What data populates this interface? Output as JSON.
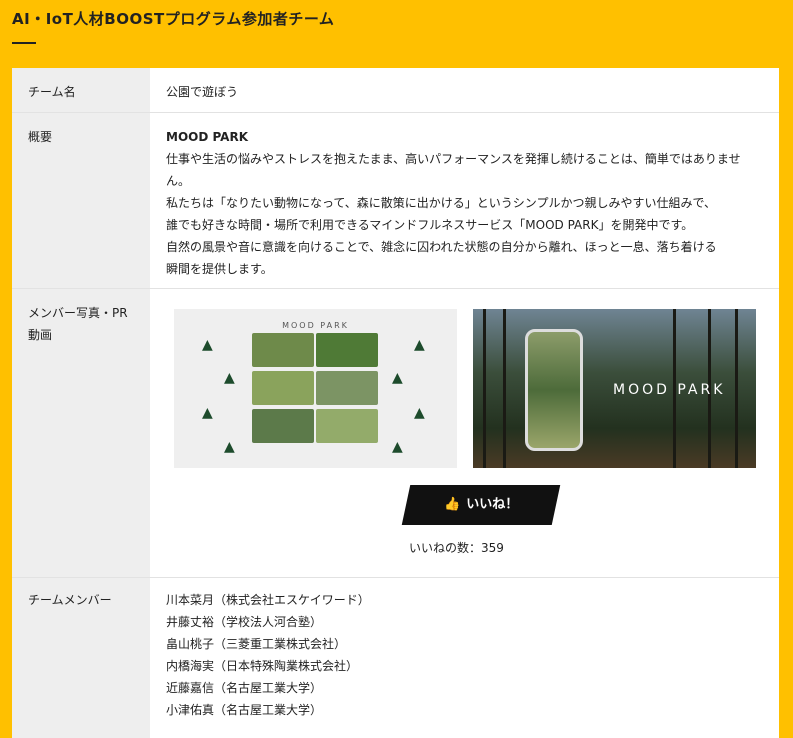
{
  "header": {
    "title": "AI・IoT人材BOOSTプログラム参加者チーム"
  },
  "table": {
    "team_name_label": "チーム名",
    "team_name_value": "公園で遊ぼう",
    "summary_label": "概要",
    "summary_title": "MOOD PARK",
    "summary_paragraphs": [
      "仕事や生活の悩みやストレスを抱えたまま、高いパフォーマンスを発揮し続けることは、簡単ではありません。",
      "私たちは「なりたい動物になって、森に散策に出かける」というシンプルかつ親しみやすい仕組みで、",
      "誰でも好きな時間・場所で利用できるマインドフルネスサービス「MOOD PARK」を開発中です。",
      "自然の風景や音に意識を向けることで、雑念に囚われた状態の自分から離れ、ほっと一息、落ち着ける",
      "瞬間を提供します。"
    ],
    "media_label": "メンバー写真・PR動画",
    "media_image_logo": "MOOD PARK",
    "media_video_logo": "MOOD PARK",
    "like_label": "いいね！",
    "like_count_text": "いいねの数：359",
    "members_label": "チームメンバー",
    "members": [
      "川本菜月（株式会社エスケイワード）",
      "井藤丈裕（学校法人河合塾）",
      "畠山桃子（三菱重工業株式会社）",
      "内橋海実（日本特殊陶業株式会社）",
      "近藤嘉信（名古屋工業大学）",
      "小津佑真（名古屋工業大学）"
    ]
  },
  "colors": {
    "background": "#ffc000",
    "label_cell": "#eeeeee",
    "like_button": "#111111",
    "tree": "#1d4b2c"
  }
}
